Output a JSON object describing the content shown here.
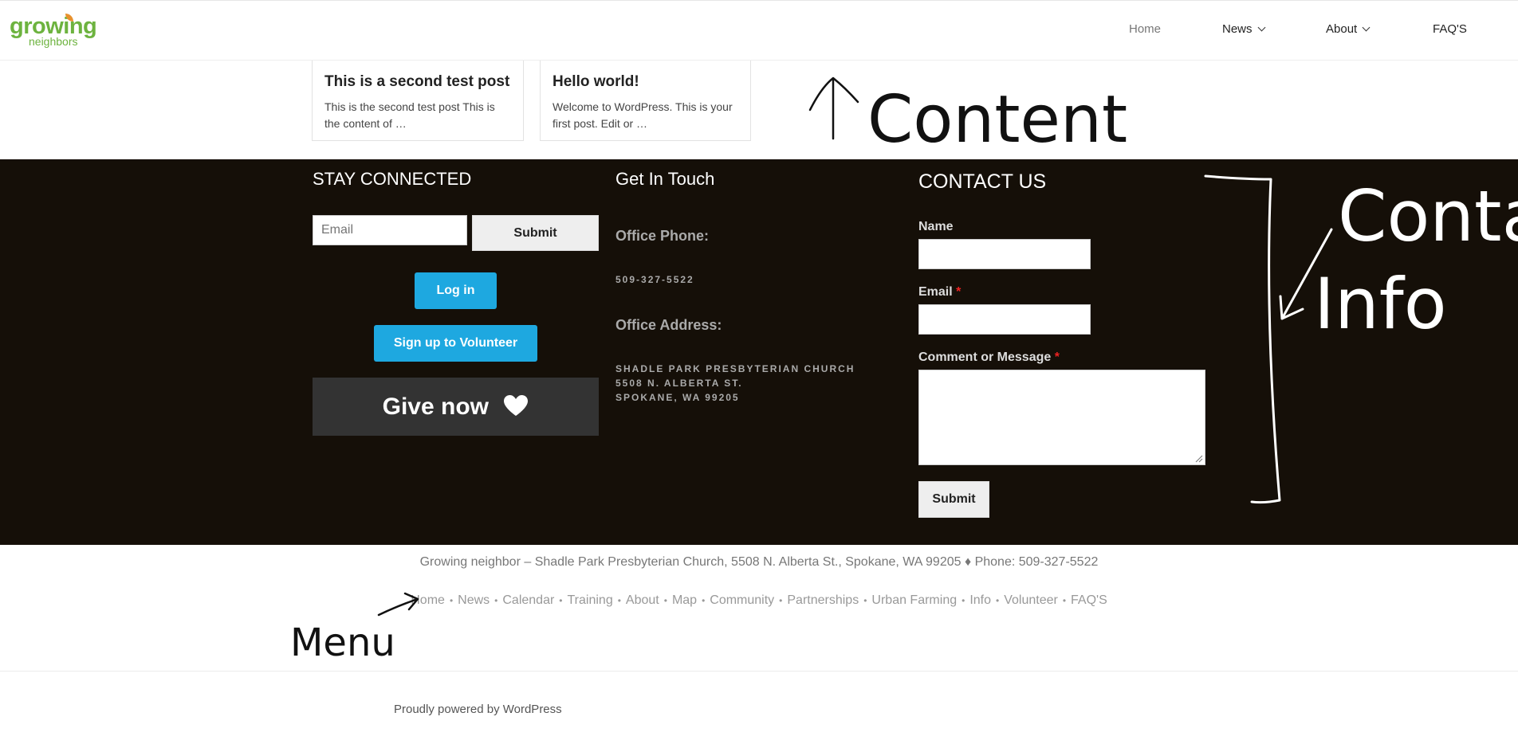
{
  "header": {
    "logo_line1": "growing",
    "logo_line2": "neighbors",
    "nav": [
      {
        "label": "Home"
      },
      {
        "label": "News"
      },
      {
        "label": "About"
      },
      {
        "label": "FAQ'S"
      }
    ]
  },
  "posts": [
    {
      "title": "This is a second test post",
      "excerpt_line1": "This is the second test post This is",
      "excerpt_line2": "the content of …"
    },
    {
      "title": "Hello world!",
      "excerpt_line1": "Welcome to WordPress. This is your",
      "excerpt_line2": "first post. Edit or …"
    }
  ],
  "stay_connected": {
    "heading": "STAY CONNECTED",
    "email_placeholder": "Email",
    "submit_label": "Submit",
    "login_label": "Log in",
    "volunteer_label": "Sign up to Volunteer",
    "give_label": "Give now"
  },
  "get_in_touch": {
    "heading": "Get In Touch",
    "phone_label": "Office Phone:",
    "phone_value": "509-327-5522",
    "address_label": "Office Address:",
    "address_line1": "SHADLE PARK PRESBYTERIAN CHURCH",
    "address_line2": "5508 N. ALBERTA ST.",
    "address_line3": "SPOKANE, WA 99205"
  },
  "contact_us": {
    "heading": "CONTACT US",
    "name_label": "Name",
    "email_label": "Email",
    "message_label": "Comment or Message",
    "required_mark": "*",
    "submit_label": "Submit"
  },
  "footer": {
    "copyright": "Growing neighbor – Shadle Park Presbyterian Church, 5508 N. Alberta St., Spokane, WA 99205 ♦ Phone: 509-327-5522",
    "menu": [
      "Home",
      "News",
      "Calendar",
      "Training",
      "About",
      "Map",
      "Community",
      "Partnerships",
      "Urban Farming",
      "Info",
      "Volunteer",
      "FAQ'S"
    ],
    "separator": "•",
    "powered_by": "Proudly powered by WordPress"
  },
  "annotations": {
    "content": "Content",
    "contact_line1": "Contact",
    "contact_line2": "Info",
    "menu": "Menu"
  },
  "colors": {
    "brand_green": "#6db33f",
    "footer_bg": "#150f08",
    "button_blue": "#1ea8e0",
    "give_bg": "#333333"
  }
}
